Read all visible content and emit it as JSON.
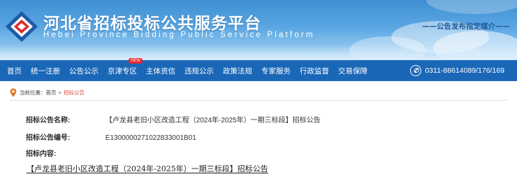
{
  "header": {
    "title": "河北省招标投标公共服务平台",
    "subtitle": "Hebei Province Bidding Public Service Platform",
    "slogan": "——公告发布指定媒介——",
    "logo_icon": "diamond-logo-icon",
    "colors": {
      "banner_top": "#3e8fd2",
      "nav": "#1a67b8",
      "accent_red": "#d8463a"
    }
  },
  "nav": {
    "items": [
      {
        "label": "首页"
      },
      {
        "label": "统一注册"
      },
      {
        "label": "公告公示"
      },
      {
        "label": "京津专区",
        "badge": "NEW"
      },
      {
        "label": "主体资信"
      },
      {
        "label": "违规公示"
      },
      {
        "label": "政策法规"
      },
      {
        "label": "专家服务"
      },
      {
        "label": "行政监督"
      },
      {
        "label": "交易保障"
      }
    ],
    "phone_icon": "phone-icon",
    "phone": "0311-88614089/176/169"
  },
  "breadcrumb": {
    "prefix": "当前位置：",
    "home": "首页",
    "separator": ">",
    "current": "招标公告",
    "icon": "location-pin-icon"
  },
  "detail": {
    "name_label": "招标公告名称:",
    "name_value": "【卢龙县老旧小区改造工程（2024年-2025年）一期三标段】招标公告",
    "code_label": "招标公告编号:",
    "code_value": "E1300000271022833001B01",
    "content_label": "招标内容:",
    "content_title": "【卢龙县老旧小区改造工程（2024年-2025年）一期三标段】招标公告"
  }
}
